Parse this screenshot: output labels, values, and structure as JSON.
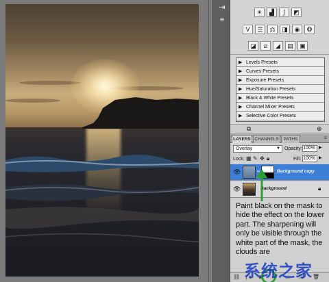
{
  "adjustments": {
    "icons_row1": [
      "brightness-icon",
      "levels-icon",
      "curves-icon",
      "exposure-icon"
    ],
    "icons_row2": [
      "vibrance-icon",
      "hue-saturation-icon",
      "color-balance-icon",
      "black-white-icon",
      "photo-filter-icon",
      "channel-mixer-icon"
    ],
    "icons_row3": [
      "invert-icon",
      "posterize-icon",
      "threshold-icon",
      "gradient-map-icon",
      "selective-color-icon"
    ]
  },
  "presets": {
    "items": [
      "Levels Presets",
      "Curves Presets",
      "Exposure Presets",
      "Hue/Saturation Presets",
      "Black & White Presets",
      "Channel Mixer Presets",
      "Selective Color Presets"
    ]
  },
  "layers_panel": {
    "tabs": [
      "LAYERS",
      "CHANNELS",
      "PATHS"
    ],
    "blend_mode": "Overlay",
    "opacity_label": "Opacity:",
    "opacity_value": "100%",
    "lock_label": "Lock:",
    "fill_label": "Fill:",
    "fill_value": "100%",
    "layers": [
      {
        "name": "Background copy",
        "selected": true
      },
      {
        "name": "Background",
        "selected": false
      }
    ]
  },
  "note": {
    "text": "Paint black on the mask to hide the effect on the lower part. The sharpening will only be visible through the white part of the mask, the clouds are"
  },
  "watermark": {
    "text": "系统之家"
  },
  "colors": {
    "selection": "#3d7fd6",
    "arrow": "#2ea02e",
    "watermark": "#1a3fc0"
  }
}
